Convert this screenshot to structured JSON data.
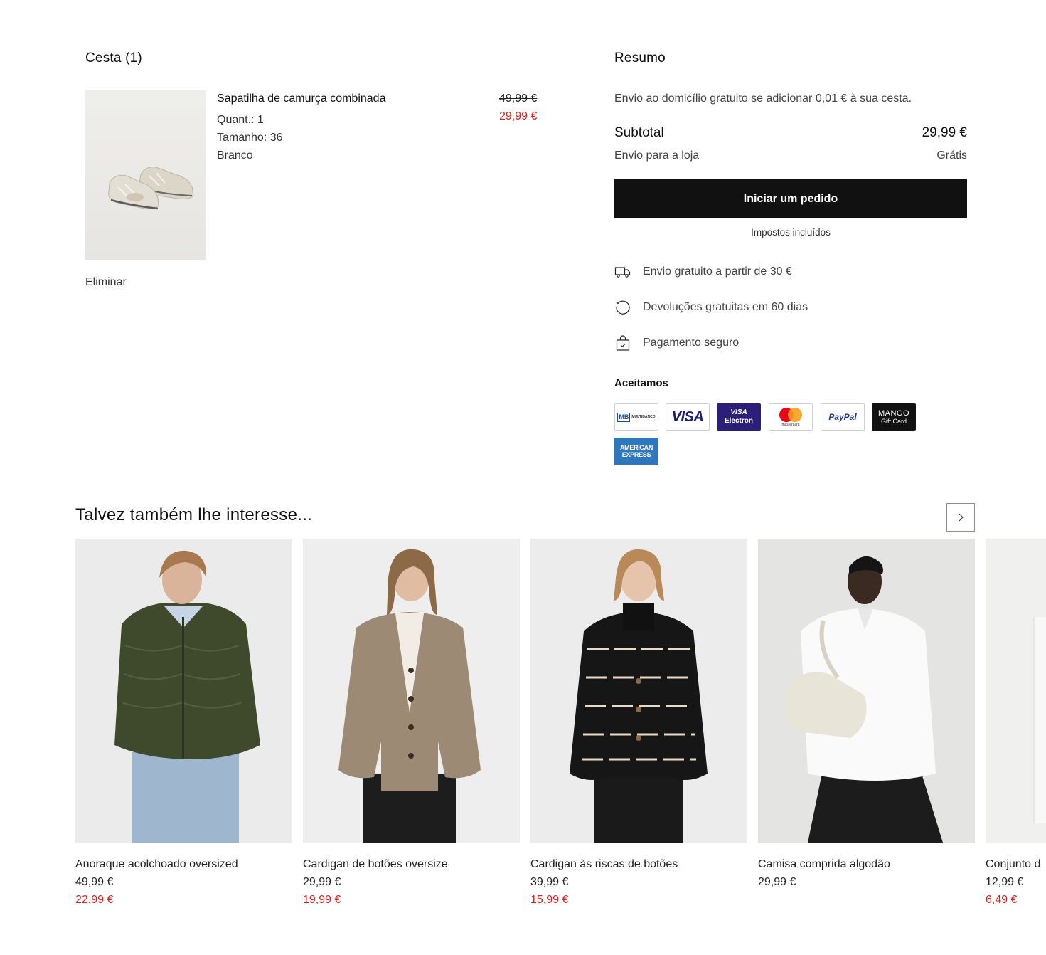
{
  "basket": {
    "title": "Cesta (1)",
    "item": {
      "name": "Sapatilha de camurça combinada",
      "qty": "Quant.: 1",
      "size": "Tamanho: 36",
      "color": "Branco",
      "old_price": "49,99 €",
      "new_price": "29,99 €",
      "image_icon": "sneaker-image"
    },
    "remove_label": "Eliminar"
  },
  "summary": {
    "title": "Resumo",
    "free_shipping_note": "Envio ao domicílio gratuito se adicionar 0,01 € à sua cesta.",
    "subtotal_label": "Subtotal",
    "subtotal_value": "29,99 €",
    "shipping_label": "Envio para a loja",
    "shipping_value": "Grátis",
    "checkout_label": "Iniciar um pedido",
    "taxes_note": "Impostos incluídos",
    "benefits": [
      {
        "icon": "truck-icon",
        "label": "Envio gratuito a partir de 30 €"
      },
      {
        "icon": "return-icon",
        "label": "Devoluções gratuitas em 60 dias"
      },
      {
        "icon": "secure-bag-icon",
        "label": "Pagamento seguro"
      }
    ],
    "accept_title": "Aceitamos",
    "payment_methods": {
      "multibanco": {
        "mark": "MB",
        "text": "MULTIBANCO"
      },
      "visa": "VISA",
      "visa_electron": {
        "top": "VISA",
        "bottom": "Electron"
      },
      "mastercard": "mastercard",
      "paypal": "PayPal",
      "mango_gift": {
        "top": "MANGO",
        "bottom": "Gift Card"
      },
      "amex": {
        "top": "AMERICAN",
        "bottom": "EXPRESS"
      }
    }
  },
  "recommendations": {
    "title": "Talvez também lhe interesse...",
    "next_icon": "chevron-right-icon",
    "products": [
      {
        "name": "Anoraque acolchoado oversized",
        "old_price": "49,99 €",
        "price": "22,99 €"
      },
      {
        "name": "Cardigan de botões oversize",
        "old_price": "29,99 €",
        "price": "19,99 €"
      },
      {
        "name": "Cardigan às riscas de botões",
        "old_price": "39,99 €",
        "price": "15,99 €"
      },
      {
        "name": "Camisa comprida algodão",
        "price": "29,99 €"
      },
      {
        "name": "Conjunto d",
        "old_price": "12,99 €",
        "price": "6,49 €"
      }
    ]
  },
  "colors": {
    "sale_red": "#e0201c",
    "cta_black": "#111111",
    "visa_blue": "#1a1f71",
    "visa_electron_bg": "#2b1f7a",
    "amex_blue": "#2e77bc",
    "mastercard_red": "#eb001b",
    "mastercard_orange": "#f79e1b"
  }
}
